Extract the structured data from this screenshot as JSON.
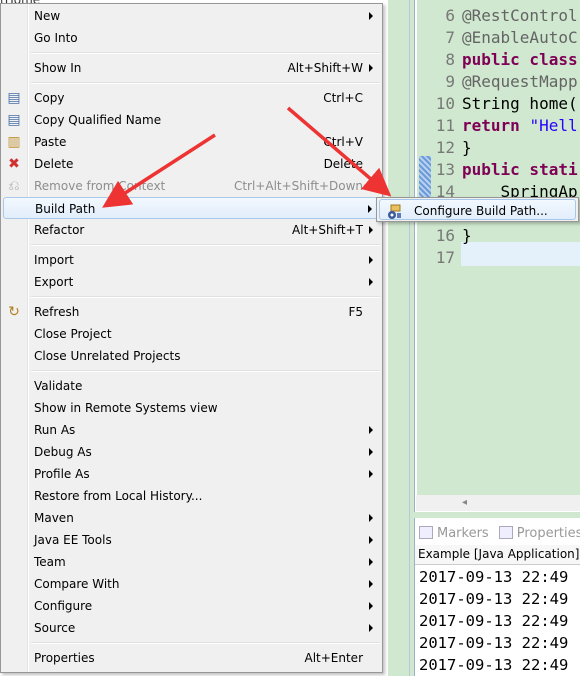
{
  "top_fragment": "tHome",
  "menu": [
    {
      "label": "New",
      "arrow": true
    },
    {
      "label": "Go Into"
    },
    {
      "sep": true
    },
    {
      "label": "Show In",
      "shortcut": "Alt+Shift+W",
      "arrow": true
    },
    {
      "sep": true
    },
    {
      "label": "Copy",
      "shortcut": "Ctrl+C",
      "icon": "copy-icon"
    },
    {
      "label": "Copy Qualified Name",
      "icon": "copy-qualified-icon"
    },
    {
      "label": "Paste",
      "shortcut": "Ctrl+V",
      "icon": "paste-icon"
    },
    {
      "label": "Delete",
      "shortcut": "Delete",
      "icon": "delete-icon"
    },
    {
      "label": "Remove from Context",
      "shortcut": "Ctrl+Alt+Shift+Down",
      "icon": "remove-context-icon",
      "disabled": true
    },
    {
      "label": "Build Path",
      "arrow": true,
      "highlighted": true
    },
    {
      "label": "Refactor",
      "shortcut": "Alt+Shift+T",
      "arrow": true
    },
    {
      "sep": true
    },
    {
      "label": "Import",
      "arrow": true
    },
    {
      "label": "Export",
      "arrow": true
    },
    {
      "sep": true
    },
    {
      "label": "Refresh",
      "shortcut": "F5",
      "icon": "refresh-icon"
    },
    {
      "label": "Close Project"
    },
    {
      "label": "Close Unrelated Projects"
    },
    {
      "sep": true
    },
    {
      "label": "Validate"
    },
    {
      "label": "Show in Remote Systems view"
    },
    {
      "label": "Run As",
      "arrow": true
    },
    {
      "label": "Debug As",
      "arrow": true
    },
    {
      "label": "Profile As",
      "arrow": true
    },
    {
      "label": "Restore from Local History..."
    },
    {
      "label": "Maven",
      "arrow": true
    },
    {
      "label": "Java EE Tools",
      "arrow": true
    },
    {
      "label": "Team",
      "arrow": true
    },
    {
      "label": "Compare With",
      "arrow": true
    },
    {
      "label": "Configure",
      "arrow": true
    },
    {
      "label": "Source",
      "arrow": true
    },
    {
      "sep": true
    },
    {
      "label": "Properties",
      "shortcut": "Alt+Enter"
    }
  ],
  "submenu": {
    "label": "Configure Build Path...",
    "icon": "configure-build-path-icon"
  },
  "editor": {
    "lines": [
      {
        "n": "6",
        "parts": [
          [
            "ann",
            "@RestControl"
          ]
        ]
      },
      {
        "n": "7",
        "parts": [
          [
            "ann",
            "@EnableAutoC"
          ]
        ]
      },
      {
        "n": "8",
        "parts": [
          [
            "kw",
            "public class"
          ]
        ]
      },
      {
        "n": "9",
        "parts": [
          [
            "ann",
            "@RequestMapp"
          ]
        ]
      },
      {
        "n": "10",
        "parts": [
          [
            "",
            "String home("
          ]
        ]
      },
      {
        "n": "11",
        "parts": [
          [
            "kw",
            "return "
          ],
          [
            "str",
            "\"Hell"
          ]
        ]
      },
      {
        "n": "12",
        "parts": [
          [
            "",
            "}"
          ]
        ]
      },
      {
        "n": "13",
        "parts": [
          [
            "kw",
            "public stati"
          ]
        ]
      },
      {
        "n": "14",
        "parts": [
          [
            "",
            "    SpringAp"
          ]
        ]
      },
      {
        "n": "15",
        "parts": []
      },
      {
        "n": "16",
        "parts": [
          [
            "",
            "}"
          ]
        ]
      },
      {
        "n": "17",
        "parts": []
      }
    ]
  },
  "bottom": {
    "tabs": [
      {
        "label": "Markers",
        "icon": "markers-icon"
      },
      {
        "label": "Properties",
        "icon": "properties-icon"
      }
    ],
    "console_title": "Example [Java Application] D",
    "console_lines": [
      "2017-09-13 22:49",
      "2017-09-13 22:49",
      "2017-09-13 22:49",
      "2017-09-13 22:49",
      "2017-09-13 22:49"
    ]
  },
  "annotation_color": "#ee3333"
}
